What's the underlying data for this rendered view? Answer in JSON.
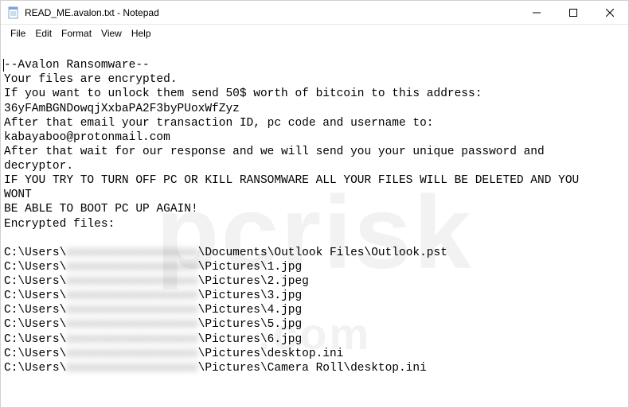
{
  "window": {
    "title": "READ_ME.avalon.txt - Notepad"
  },
  "menu": {
    "file": "File",
    "edit": "Edit",
    "format": "Format",
    "view": "View",
    "help": "Help"
  },
  "note": {
    "line1": "--Avalon Ransomware--",
    "line2": "Your files are encrypted.",
    "line3": "If you want to unlock them send 50$ worth of bitcoin to this address:",
    "line4": "36yFAmBGNDowqjXxbaPA2F3byPUoxWfZyz",
    "line5": "After that email your transaction ID, pc code and username to:",
    "line6": "kabayaboo@protonmail.com",
    "line7": "After that wait for our response and we will send you your unique password and",
    "line8": "decryptor.",
    "line9": "IF YOU TRY TO TURN OFF PC OR KILL RANSOMWARE ALL YOUR FILES WILL BE DELETED AND YOU",
    "line10": "WONT",
    "line11": "BE ABLE TO BOOT PC UP AGAIN!",
    "line12": "Encrypted files:"
  },
  "files": {
    "prefix": "C:\\Users\\",
    "redacted": "xxxxxxxxxxxxxxxxxxx",
    "f1": "\\Documents\\Outlook Files\\Outlook.pst",
    "f2": "\\Pictures\\1.jpg",
    "f3": "\\Pictures\\2.jpeg",
    "f4": "\\Pictures\\3.jpg",
    "f5": "\\Pictures\\4.jpg",
    "f6": "\\Pictures\\5.jpg",
    "f7": "\\Pictures\\6.jpg",
    "f8": "\\Pictures\\desktop.ini",
    "f9": "\\Pictures\\Camera Roll\\desktop.ini"
  },
  "watermark": {
    "big": "pcrisk",
    "small": ".com"
  }
}
